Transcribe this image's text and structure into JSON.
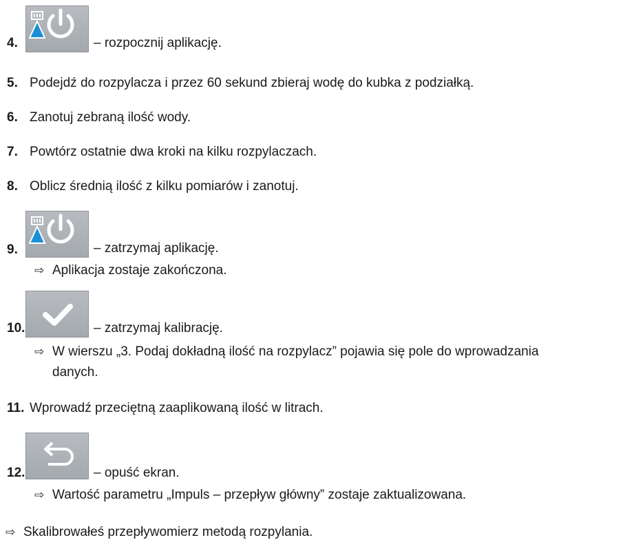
{
  "steps": [
    {
      "num": "4.",
      "text": "– rozpocznij aplikację.",
      "icon": "spray-start-icon"
    },
    {
      "num": "5.",
      "text": "Podejdź do rozpylacza i przez 60 sekund zbieraj wodę do kubka z podziałką."
    },
    {
      "num": "6.",
      "text": "Zanotuj zebraną ilość wody."
    },
    {
      "num": "7.",
      "text": "Powtórz ostatnie dwa kroki na kilku rozpylaczach."
    },
    {
      "num": "8.",
      "text": "Oblicz średnią ilość z kilku pomiarów i zanotuj."
    },
    {
      "num": "9.",
      "text": "– zatrzymaj aplikację.",
      "icon": "spray-stop-icon",
      "result": "Aplikacja zostaje zakończona."
    },
    {
      "num": "10.",
      "text": "– zatrzymaj kalibrację.",
      "icon": "checkmark-icon",
      "result_line1": "W wierszu „3. Podaj dokładną ilość na rozpylacz” pojawia się pole do wprowadzania",
      "result_line2": "danych."
    },
    {
      "num": "11.",
      "text": "Wprowadź przeciętną zaaplikowaną ilość w litrach."
    },
    {
      "num": "12.",
      "text": "– opuść ekran.",
      "icon": "back-icon",
      "result": "Wartość parametru „Impuls – przepływ główny” zostaje zaktualizowana."
    }
  ],
  "final_result": "Skalibrowałeś przepływomierz metodą rozpylania.",
  "arrow_glyph": "⇨",
  "colors": {
    "button_bg": "#aeb2b7",
    "icon_white": "#ffffff",
    "drop_blue": "#1a8fd6"
  }
}
